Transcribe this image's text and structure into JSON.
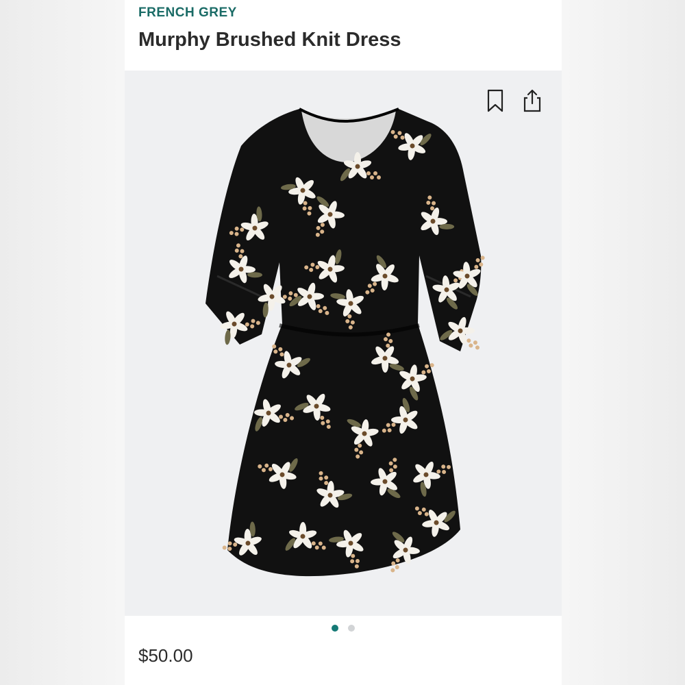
{
  "product": {
    "brand": "FRENCH GREY",
    "title": "Murphy Brushed Knit Dress",
    "price": "$50.00"
  },
  "image": {
    "alt": "Black floral print dress",
    "carousel": {
      "total": 2,
      "active": 1
    }
  },
  "actions": {
    "bookmark_icon": "bookmark-icon",
    "share_icon": "share-icon"
  },
  "colors": {
    "brand": "#1a6b66",
    "accent": "#157a76",
    "photo_bg": "#eff0f2",
    "dress": "#111111",
    "flower": "#f4f1ea",
    "bud": "#d9b48a",
    "leaf": "#6e6a4a"
  }
}
